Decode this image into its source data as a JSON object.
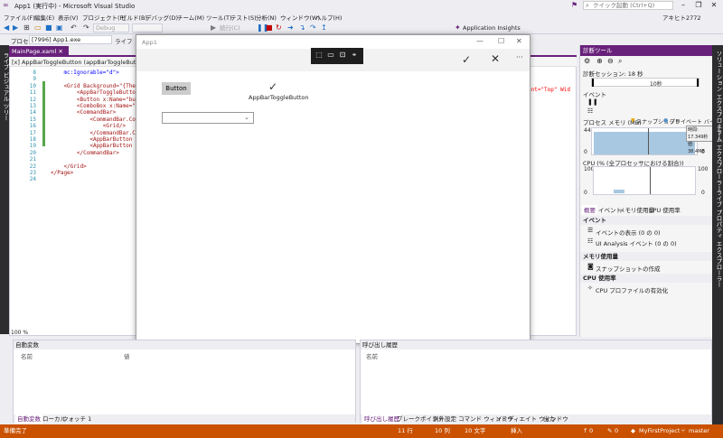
{
  "window": {
    "title": "App1 (実行中) - Microsoft Visual Studio",
    "quick_launch": "クイック起動 (Ctrl+Q)",
    "user": "アキヒト2772"
  },
  "menu": [
    "ファイル(F)",
    "編集(E)",
    "表示(V)",
    "プロジェクト(P)",
    "ビルド(B)",
    "デバッグ(D)",
    "チーム(M)",
    "ツール(T)",
    "テスト(S)",
    "分析(N)",
    "ウィンドウ(W)",
    "ヘルプ(H)"
  ],
  "toolbar": {
    "config": "Debug",
    "continue_label": "続行(C)",
    "app_insights": "Application Insights"
  },
  "procbar": {
    "process_label": "プロセス",
    "process_value": "[7996] App1.exe",
    "lifecycle": "ライフ"
  },
  "left_tabs": "ライブ ビジュアル ツリー",
  "editor": {
    "tab_label": "MainPage.xaml",
    "nav_path": "[x] AppBarToggleButton (appBarToggleButton)",
    "zoom": "100 %",
    "line_numbers": [
      "8",
      "9",
      "10",
      "11",
      "12",
      "13",
      "14",
      "15",
      "16",
      "17",
      "18",
      "19",
      "20",
      "21",
      "22",
      "23",
      "24"
    ],
    "lines": [
      "    mc:Ignorable=\"d\">",
      "",
      "    <Grid Background=\"{Theme",
      "        <AppBarToggleButton",
      "        <Button x:Name=\"butt",
      "        <ComboBox x:Name=\"co",
      "        <CommandBar>",
      "            <CommandBar.Cont",
      "                <Grid/>",
      "            </CommandBar.Co",
      "            <AppBarButton Ic",
      "            <AppBarButton Ic",
      "        </CommandBar>",
      "",
      "    </Grid>",
      "</Page>",
      ""
    ],
    "right_fragment": "ent=\"Top\" Wid"
  },
  "app": {
    "title": "App1",
    "button_label": "Button",
    "toggle_label": "AppBarToggleButton"
  },
  "diag": {
    "title": "診断ツール",
    "session": "診断セッション: 18 秒",
    "time_tick": "10秒",
    "events_label": "イベント",
    "memory_label": "プロセス メモリ (MB)",
    "snapshot_legend": "スナップショット",
    "private_legend": "プライベート バイト",
    "tooltip_time": "時間: 17.349秒",
    "tooltip_value": "値: 38.4MB",
    "mem_max": "44",
    "mem_min": "0",
    "cpu_label": "CPU (% (全プロセッサにおける割合))",
    "cpu_max": "100",
    "cpu_min": "0",
    "tabs": [
      "概要",
      "イベント",
      "メモリ使用量",
      "CPU 使用率"
    ],
    "sections": [
      {
        "head": "イベント",
        "items": [
          "イベントの表示 (0 の 0)",
          "UI Analysis イベント (0 の 0)"
        ]
      },
      {
        "head": "メモリ使用量",
        "items": [
          "スナップショットの作成"
        ]
      },
      {
        "head": "CPU 使用率",
        "items": [
          "CPU プロファイルの有効化"
        ]
      }
    ]
  },
  "right_tabs": [
    "ソリューション エクスプローラー",
    "チーム エクスプローラー",
    "ライブ プロパティ エクスプローラー"
  ],
  "bottom_left": {
    "title": "自動変数",
    "col_name": "名前",
    "col_value": "値",
    "tabs": [
      "自動変数",
      "ローカル",
      "ウォッチ 1"
    ]
  },
  "bottom_right": {
    "title": "呼び出し履歴",
    "col_name": "名前",
    "tabs": [
      "呼び出し履歴",
      "ブレークポイント",
      "例外設定",
      "コマンド ウィンドウ",
      "イミディエイト ウィンドウ",
      "出力"
    ]
  },
  "status": {
    "ready": "準備完了",
    "line": "11 行",
    "col": "10 列",
    "char": "10 文字",
    "mode": "挿入",
    "up": "0",
    "pencil": "0",
    "repo": "MyFirstProject",
    "branch": "master"
  },
  "colors": {
    "accent": "#68217a",
    "status": "#ca5100",
    "chart_fill": "#a7c8e0"
  }
}
